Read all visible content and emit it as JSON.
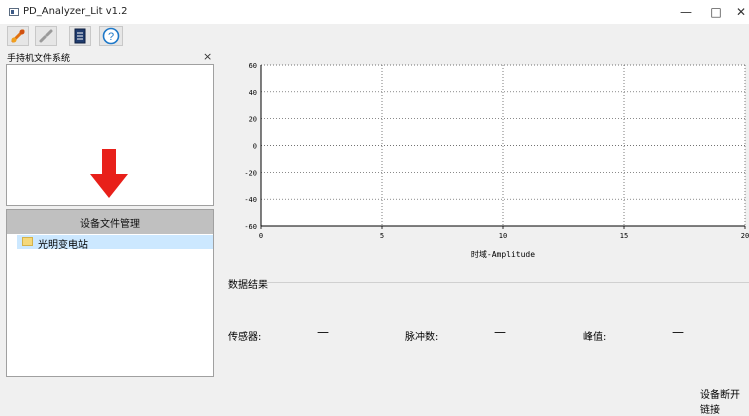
{
  "window": {
    "title": "PD_Analyzer_Lit v1.2",
    "minimize_glyph": "—",
    "maximize_glyph": "□",
    "close_glyph": "✕"
  },
  "toolbar": {
    "buttons": [
      {
        "name": "connect-icon"
      },
      {
        "name": "disconnect-icon"
      },
      {
        "name": "document-icon"
      },
      {
        "name": "help-icon",
        "glyph": "?"
      }
    ]
  },
  "filesystem_panel": {
    "title": "手持机文件系统",
    "close_glyph": "×"
  },
  "device_manager": {
    "title": "设备文件管理",
    "items": [
      {
        "label": "光明变电站",
        "selected": true
      }
    ]
  },
  "chart_data": {
    "type": "line",
    "title": "",
    "xlabel": "时域-Amplitude",
    "ylabel": "",
    "xlim": [
      0,
      20
    ],
    "ylim": [
      -60,
      60
    ],
    "x_ticks": [
      "0",
      "5",
      "10",
      "15",
      "20"
    ],
    "y_ticks": [
      "60",
      "40",
      "20",
      "0",
      "-20",
      "-40",
      "-60"
    ],
    "grid": true,
    "series": []
  },
  "results": {
    "title": "数据结果",
    "fields": [
      {
        "label": "传感器:",
        "value": "—"
      },
      {
        "label": "脉冲数:",
        "value": "—"
      },
      {
        "label": "峰值:",
        "value": "—"
      }
    ]
  },
  "status": {
    "text": "设备断开链接"
  },
  "colors": {
    "arrow": "#e8201a",
    "selection": "#cce8ff",
    "panel_header": "#c0c0c0",
    "help_blue": "#1e78c8"
  }
}
